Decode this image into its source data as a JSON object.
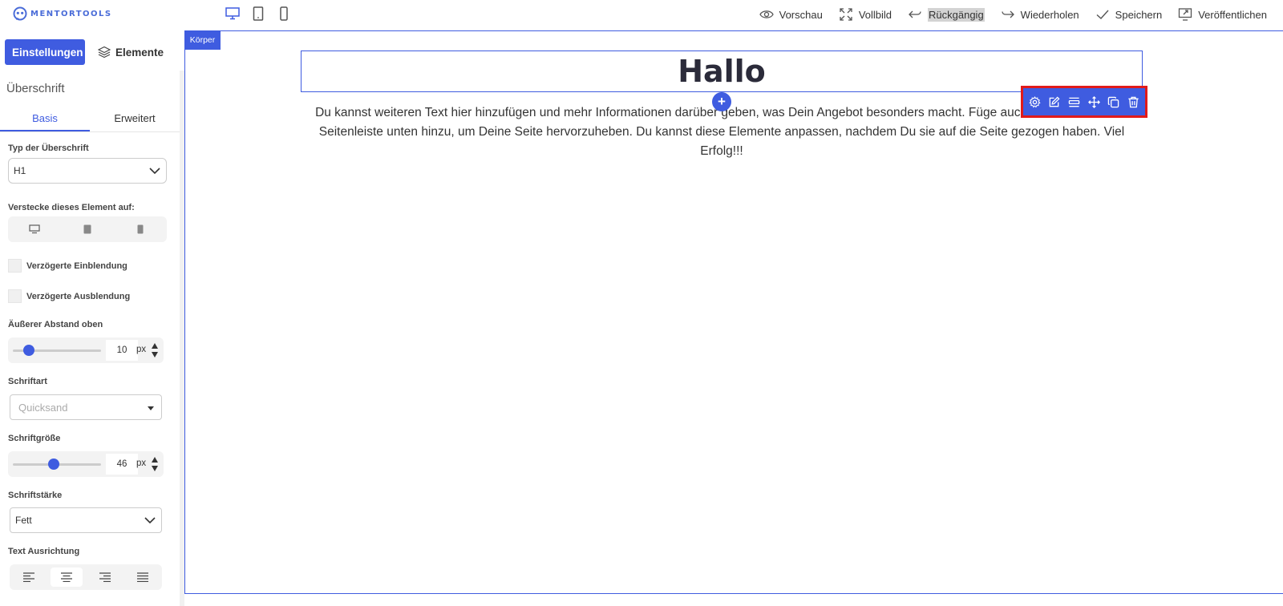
{
  "app": {
    "logo_text": "MENTORTOOLS"
  },
  "topbar": {
    "devices": [
      {
        "icon": "desktop-icon",
        "active": true
      },
      {
        "icon": "tablet-icon",
        "active": false
      },
      {
        "icon": "mobile-icon",
        "active": false
      }
    ],
    "actions": {
      "preview": "Vorschau",
      "fullscreen": "Vollbild",
      "undo": "Rückgängig",
      "redo": "Wiederholen",
      "save": "Speichern",
      "publish": "Veröffentlichen"
    }
  },
  "sidebar": {
    "tabs": {
      "settings": "Einstellungen",
      "elements": "Elemente"
    },
    "title": "Überschrift",
    "subtabs": {
      "basic": "Basis",
      "advanced": "Erweitert"
    },
    "heading_type": {
      "label": "Typ der Überschrift",
      "value": "H1"
    },
    "hide_on": {
      "label": "Verstecke dieses Element auf:"
    },
    "delayed_show": {
      "label": "Verzögerte Einblendung",
      "checked": false
    },
    "delayed_hide": {
      "label": "Verzögerte Ausblendung",
      "checked": false
    },
    "margin_top": {
      "label": "Äußerer Abstand oben",
      "value": "10",
      "unit": "px",
      "fraction": 0.14
    },
    "font_family": {
      "label": "Schriftart",
      "placeholder": "Quicksand"
    },
    "font_size": {
      "label": "Schriftgröße",
      "value": "46",
      "unit": "px",
      "fraction": 0.46
    },
    "font_weight": {
      "label": "Schriftstärke",
      "value": "Fett"
    },
    "text_align": {
      "label": "Text Ausrichtung",
      "options": [
        "align-left",
        "align-center",
        "align-right",
        "align-justify"
      ],
      "selected": "align-center"
    }
  },
  "canvas": {
    "body_badge": "Körper",
    "heading": "Hallo",
    "paragraph": "Du kannst weiteren Text hier hinzufügen und mehr Informationen darüber geben, was Dein Angebot besonders macht. Füge auch Elemente aus der Seitenleiste unten hinzu, um Deine Seite hervorzuheben. Du kannst diese Elemente anpassen, nachdem Du sie auf die Seite gezogen haben. Viel Erfolg!!!",
    "add_label": "+",
    "toolbar_icons": [
      "settings-icon",
      "edit-icon",
      "align-icon",
      "move-icon",
      "copy-icon",
      "delete-icon"
    ]
  },
  "colors": {
    "accent": "#3f5ce0",
    "highlight": "#e11a1a"
  }
}
